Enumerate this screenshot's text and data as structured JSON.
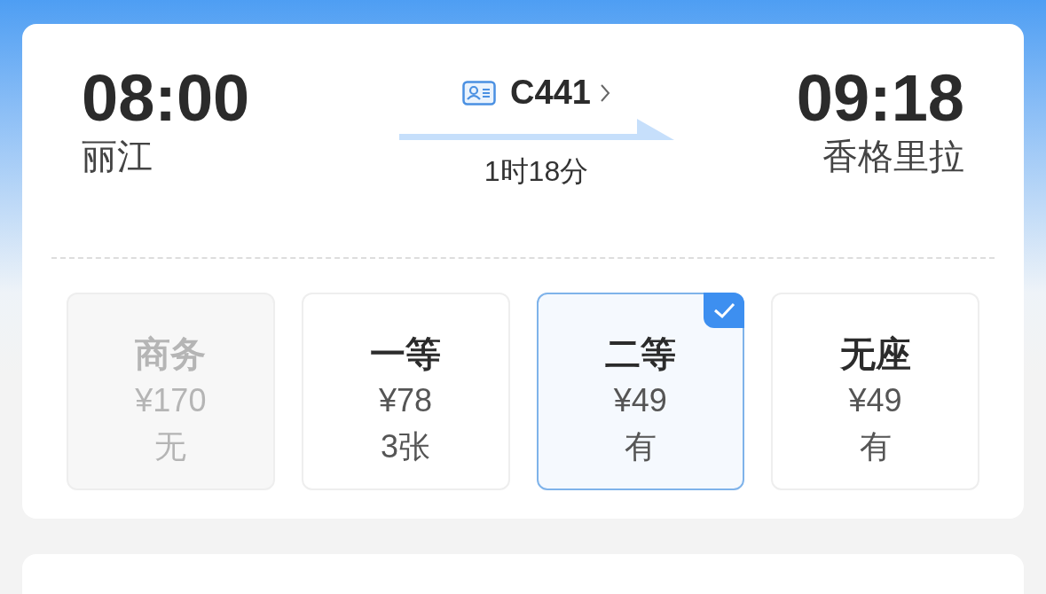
{
  "departure": {
    "time": "08:00",
    "station": "丽江"
  },
  "train": {
    "number": "C441",
    "duration": "1时18分"
  },
  "arrival": {
    "time": "09:18",
    "station": "香格里拉"
  },
  "seats": [
    {
      "name": "商务",
      "price": "¥170",
      "availability": "无",
      "disabled": true,
      "selected": false
    },
    {
      "name": "一等",
      "price": "¥78",
      "availability": "3张",
      "disabled": false,
      "selected": false
    },
    {
      "name": "二等",
      "price": "¥49",
      "availability": "有",
      "disabled": false,
      "selected": true
    },
    {
      "name": "无座",
      "price": "¥49",
      "availability": "有",
      "disabled": false,
      "selected": false
    }
  ]
}
